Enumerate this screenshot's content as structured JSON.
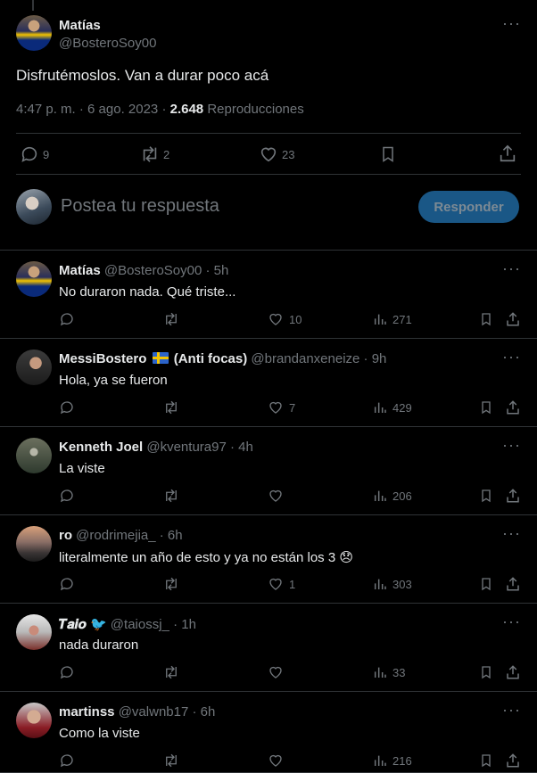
{
  "main": {
    "name": "Matías",
    "handle": "@BosteroSoy00",
    "text": "Disfrutémoslos. Van a durar poco acá",
    "time": "4:47 p. m. · 6 ago. 2023 ·",
    "views": "2.648",
    "views_label": "Reproducciones",
    "replies": "9",
    "reposts": "2",
    "likes": "23",
    "more": "···"
  },
  "composer": {
    "placeholder": "Postea tu respuesta",
    "button": "Responder"
  },
  "replies": [
    {
      "name": "Matías",
      "handle": "@BosteroSoy00",
      "time": "· 5h",
      "text": "No duraron nada. Qué triste...",
      "likes": "10",
      "views": "271"
    },
    {
      "name": "MessiBostero",
      "name_suffix": "(Anti focas)",
      "handle": "@brandanxeneize",
      "time": "· 9h",
      "text": "Hola, ya se fueron",
      "likes": "7",
      "views": "429"
    },
    {
      "name": "Kenneth Joel",
      "handle": "@kventura97",
      "time": "· 4h",
      "text": "La viste",
      "likes": "",
      "views": "206"
    },
    {
      "name": "ro",
      "handle": "@rodrimejia_",
      "time": "· 6h",
      "text": "literalmente un año de esto y ya no están los 3 😞",
      "likes": "1",
      "views": "303"
    },
    {
      "name": "𝑻𝒂𝒊𝒐 🐦",
      "handle": "@taiossj_",
      "time": "· 1h",
      "text": "nada duraron",
      "likes": "",
      "views": "33"
    },
    {
      "name": "martinss",
      "handle": "@valwnb17",
      "time": "· 6h",
      "text": "Como la viste",
      "likes": "",
      "views": "216"
    }
  ],
  "colors": {
    "accent": "#1d9bf0",
    "background": "#000000",
    "muted": "#71767b"
  }
}
